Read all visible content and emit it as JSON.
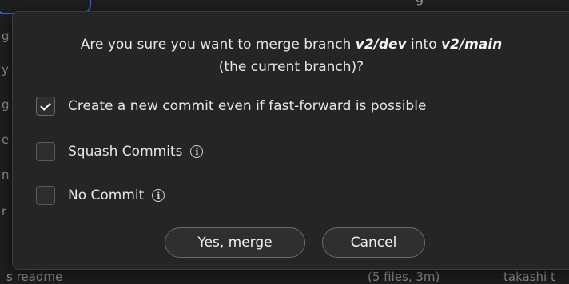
{
  "background": {
    "top_text": "g",
    "left_chars": [
      "g",
      "y",
      "g",
      "e",
      "n",
      "r"
    ],
    "bottom": {
      "left": "s readme",
      "mid": "(5 files, 3m)",
      "right": "takashi t"
    }
  },
  "dialog": {
    "question_prefix": "Are you sure you want to merge branch ",
    "source_branch": "v2/dev",
    "question_mid": " into ",
    "target_branch": "v2/main",
    "question_suffix": "(the current branch)?",
    "options": [
      {
        "label": "Create a new commit even if fast-forward is possible",
        "checked": true,
        "has_info": false
      },
      {
        "label": "Squash Commits",
        "checked": false,
        "has_info": true
      },
      {
        "label": "No Commit",
        "checked": false,
        "has_info": true
      }
    ],
    "confirm_label": "Yes, merge",
    "cancel_label": "Cancel",
    "info_glyph": "i"
  }
}
